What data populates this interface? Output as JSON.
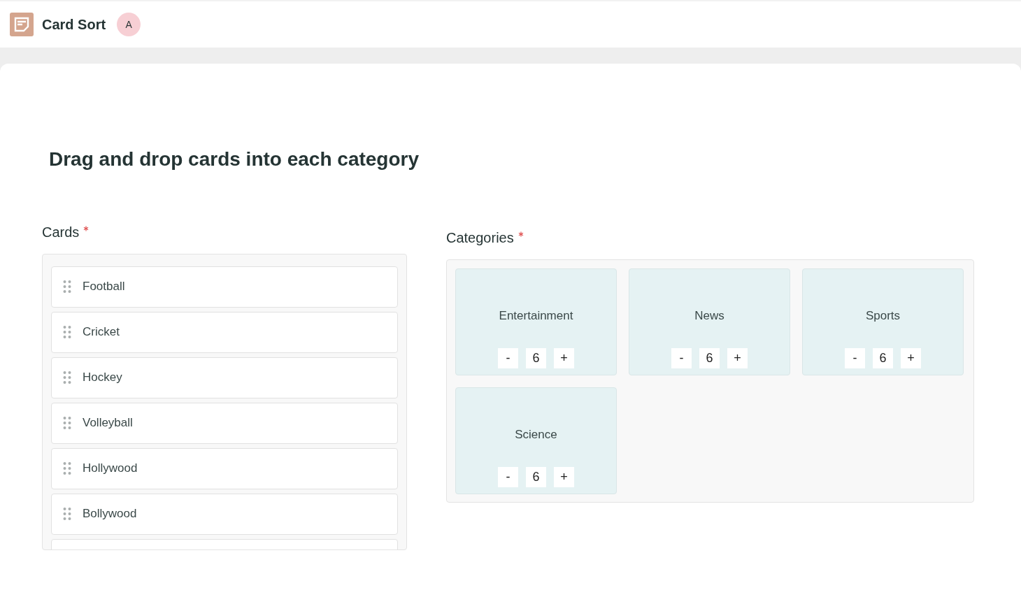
{
  "header": {
    "title": "Card Sort",
    "avatar": "A"
  },
  "heading": "Drag and drop cards into each category",
  "cards_panel": {
    "label": "Cards",
    "required": true,
    "cards": [
      {
        "label": "Football"
      },
      {
        "label": "Cricket"
      },
      {
        "label": "Hockey"
      },
      {
        "label": "Volleyball"
      },
      {
        "label": "Hollywood"
      },
      {
        "label": "Bollywood"
      }
    ]
  },
  "categories_panel": {
    "label": "Categories",
    "required": true,
    "categories": [
      {
        "name": "Entertainment",
        "decrement": "-",
        "count": "6",
        "increment": "+"
      },
      {
        "name": "News",
        "decrement": "-",
        "count": "6",
        "increment": "+"
      },
      {
        "name": "Sports",
        "decrement": "-",
        "count": "6",
        "increment": "+"
      },
      {
        "name": "Science",
        "decrement": "-",
        "count": "6",
        "increment": "+"
      }
    ]
  }
}
